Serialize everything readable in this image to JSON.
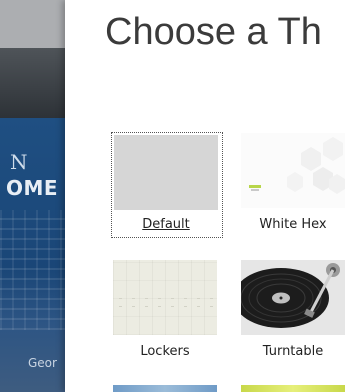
{
  "modal": {
    "title": "Choose a Th"
  },
  "background": {
    "sign_letter": "N",
    "sign_word": "OME",
    "caption": "Geor"
  },
  "themes": [
    {
      "label": "Default",
      "selected": true
    },
    {
      "label": "White Hex",
      "selected": false
    },
    {
      "label": "Lockers",
      "selected": false
    },
    {
      "label": "Turntable",
      "selected": false
    }
  ],
  "colors": {
    "default_thumb": "#d6d6d6",
    "white_hex_accent": "#b8d64a",
    "lockers": "#ecece2"
  }
}
